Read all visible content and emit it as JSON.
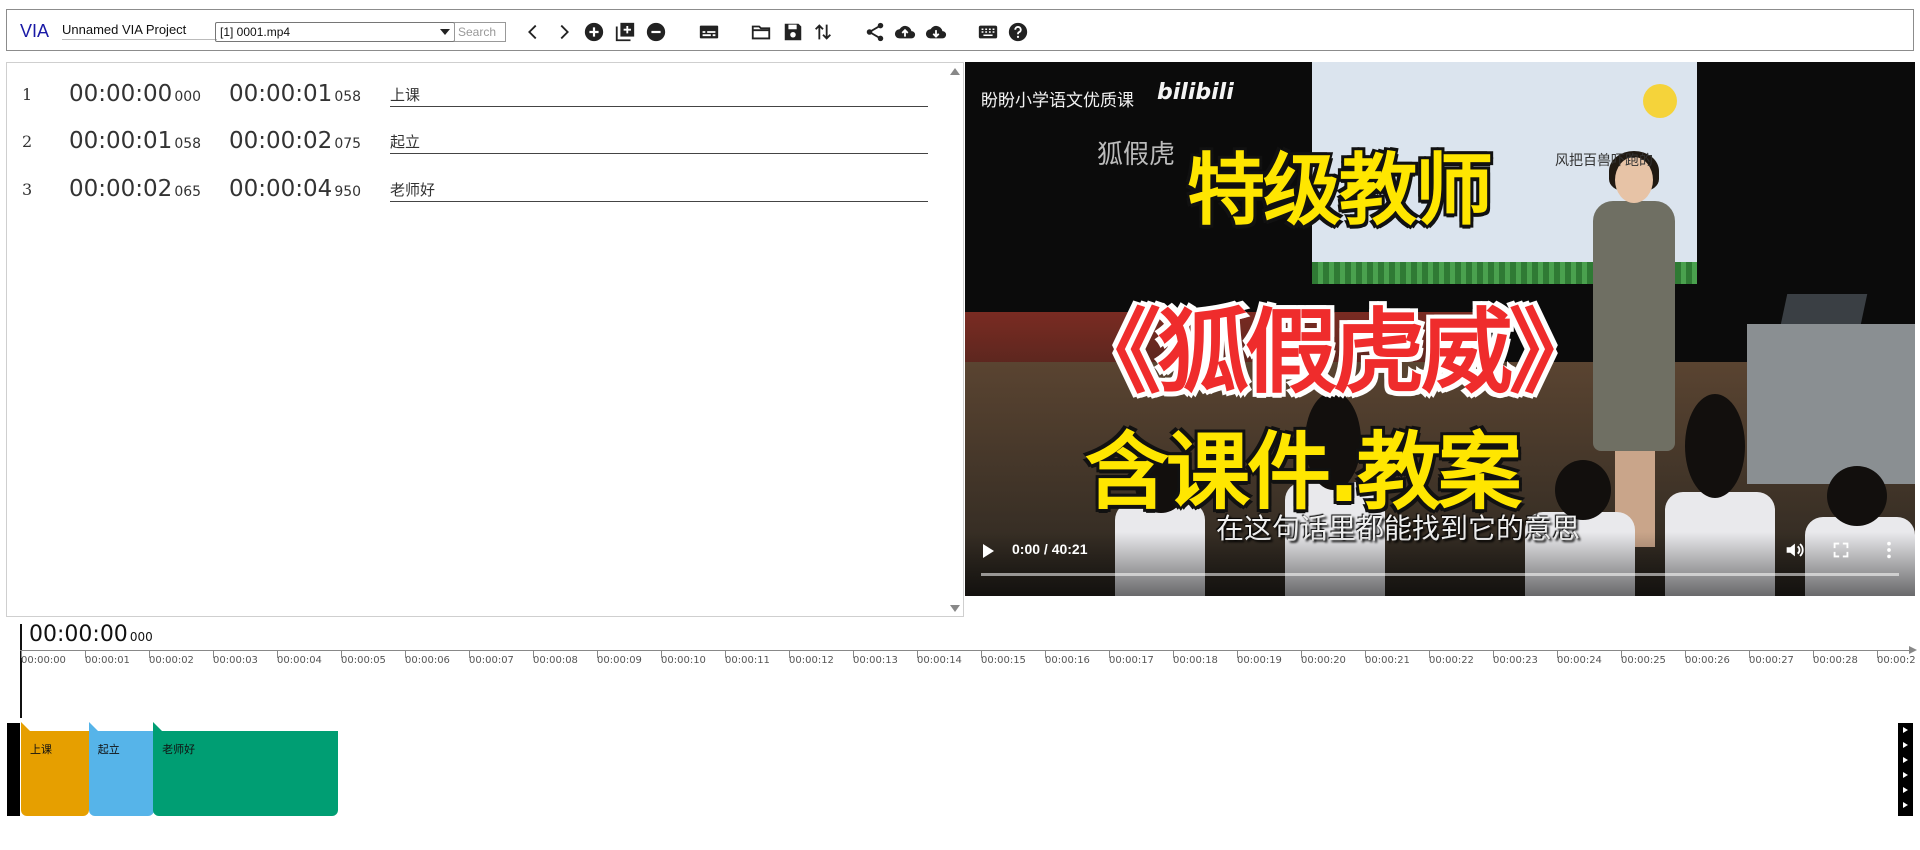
{
  "toolbar": {
    "logo": "VIA",
    "project_name": "Unnamed VIA Project",
    "file_selected": "[1] 0001.mp4",
    "search_placeholder": "Search",
    "icons": [
      "chevron-left-icon",
      "chevron-right-icon",
      "add-circle-icon",
      "add-box-icon",
      "remove-circle-icon",
      "subtitles-icon",
      "folder-open-icon",
      "save-icon",
      "swap-vert-icon",
      "share-icon",
      "cloud-upload-icon",
      "cloud-download-icon",
      "keyboard-icon",
      "help-icon"
    ]
  },
  "segments": [
    {
      "index": "1",
      "start_main": "00:00:00",
      "start_ms": "000",
      "end_main": "00:00:01",
      "end_ms": "058",
      "label": "上课"
    },
    {
      "index": "2",
      "start_main": "00:00:01",
      "start_ms": "058",
      "end_main": "00:00:02",
      "end_ms": "075",
      "label": "起立"
    },
    {
      "index": "3",
      "start_main": "00:00:02",
      "start_ms": "065",
      "end_main": "00:00:04",
      "end_ms": "950",
      "label": "老师好"
    }
  ],
  "video": {
    "channel": "盼盼小学语文优质课",
    "platform_logo": "bilibili",
    "board_text_left": "狐假虎",
    "board_text_right": "风把百兽吓跑的",
    "title_line1": "特级教师",
    "title_line2": "《狐假虎威》",
    "title_line3": "含课件.教案",
    "subtitle": "在这句话里都能找到它的意思",
    "time_display": "0:00 / 40:21",
    "progress": 0
  },
  "timeline": {
    "current_main": "00:00:00",
    "current_ms": "000",
    "ticks": [
      "00:00:00",
      "00:00:01",
      "00:00:02",
      "00:00:03",
      "00:00:04",
      "00:00:05",
      "00:00:06",
      "00:00:07",
      "00:00:08",
      "00:00:09",
      "00:00:10",
      "00:00:11",
      "00:00:12",
      "00:00:13",
      "00:00:14",
      "00:00:15",
      "00:00:16",
      "00:00:17",
      "00:00:18",
      "00:00:19",
      "00:00:20",
      "00:00:21",
      "00:00:22",
      "00:00:23",
      "00:00:24",
      "00:00:25",
      "00:00:26",
      "00:00:27",
      "00:00:28",
      "00:00:2"
    ],
    "blocks": [
      {
        "label": "上课",
        "color": "#e69f00"
      },
      {
        "label": "起立",
        "color": "#56b4e9"
      },
      {
        "label": "老师好",
        "color": "#009e73"
      }
    ]
  }
}
